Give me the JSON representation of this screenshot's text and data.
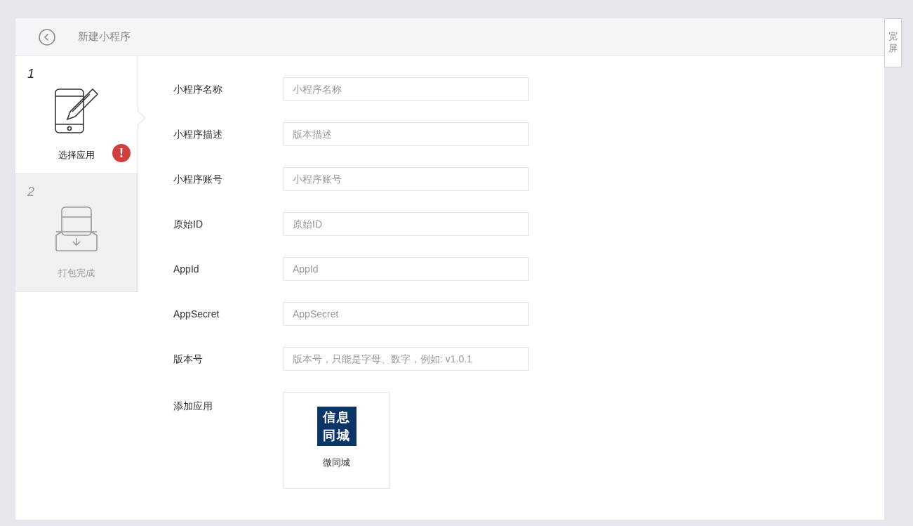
{
  "header": {
    "title": "新建小程序"
  },
  "wide_screen_button": "宽屏",
  "steps": [
    {
      "number": "1",
      "label": "选择应用",
      "kind": "edit",
      "selected": true,
      "error": true,
      "error_glyph": "!"
    },
    {
      "number": "2",
      "label": "打包完成",
      "kind": "package",
      "selected": false,
      "error": false
    }
  ],
  "fields": [
    {
      "label": "小程序名称",
      "placeholder": "小程序名称"
    },
    {
      "label": "小程序描述",
      "placeholder": "版本描述"
    },
    {
      "label": "小程序账号",
      "placeholder": "小程序账号"
    },
    {
      "label": "原始ID",
      "placeholder": "原始ID"
    },
    {
      "label": "AppId",
      "placeholder": "AppId"
    },
    {
      "label": "AppSecret",
      "placeholder": "AppSecret"
    },
    {
      "label": "版本号",
      "placeholder": "版本号，只能是字母、数字，例如: v1.0.1"
    }
  ],
  "add_app": {
    "label": "添加应用",
    "apps": [
      {
        "logo_lines": [
          "信息",
          "同城"
        ],
        "name": "微同城"
      }
    ]
  }
}
